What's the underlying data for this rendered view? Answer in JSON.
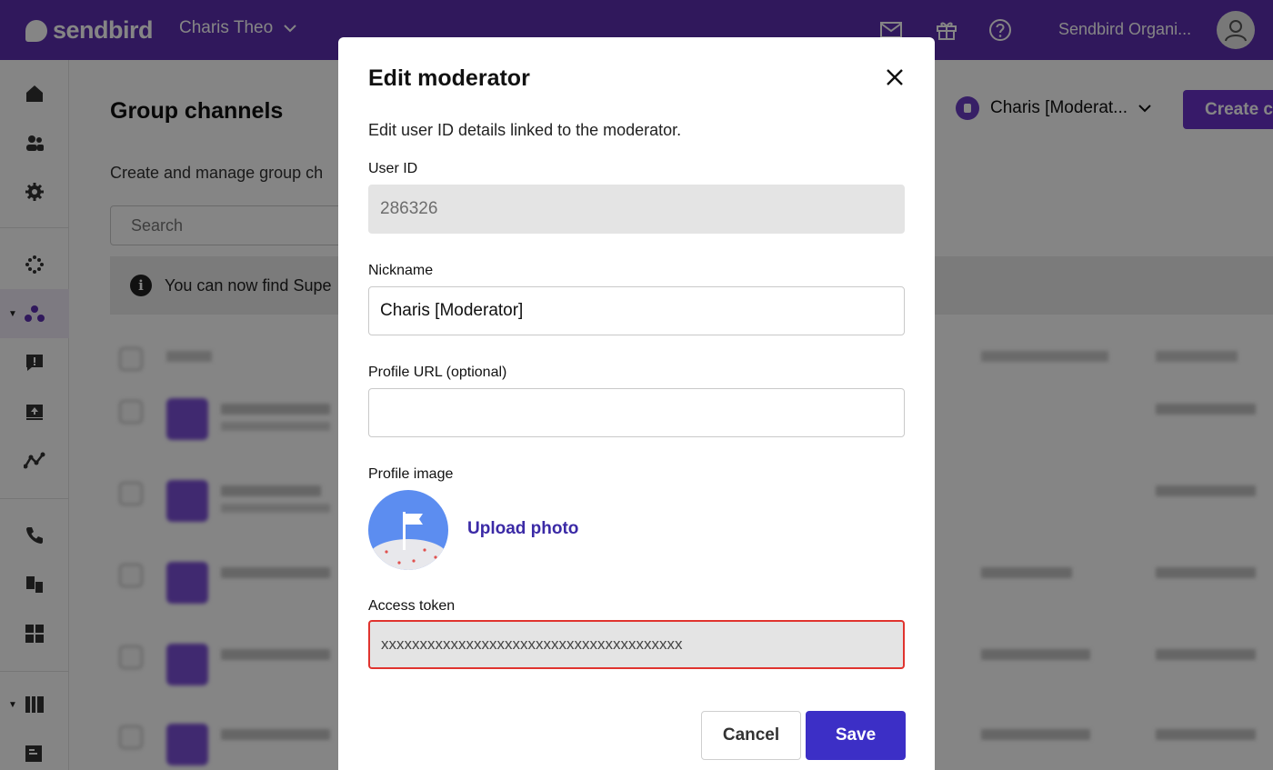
{
  "topbar": {
    "brand": "sendbird",
    "user_name": "Charis Theo",
    "org_name": "Sendbird Organi...",
    "icons": [
      "mail-icon",
      "gift-icon",
      "help-icon"
    ]
  },
  "sidebar": {
    "items": [
      "home-icon",
      "users-icon",
      "settings-icon",
      "dots-grid-icon",
      "group-channels-icon",
      "moderation-icon",
      "announcements-icon",
      "analytics-icon",
      "calls-icon",
      "devices-icon",
      "apps-icon",
      "desk-icon",
      "ticket-icon"
    ]
  },
  "main": {
    "title": "Group channels",
    "description": "Create and manage group ch",
    "search_placeholder": "Search",
    "info_text": "You can now find Supe",
    "moderator_select": "Charis [Moderat...",
    "create_button": "Create c"
  },
  "modal": {
    "title": "Edit moderator",
    "description": "Edit user ID details linked to the moderator.",
    "user_id_label": "User ID",
    "user_id_value": "286326",
    "nickname_label": "Nickname",
    "nickname_value": "Charis [Moderator]",
    "profile_url_label": "Profile URL (optional)",
    "profile_url_value": "",
    "profile_image_label": "Profile image",
    "upload_photo": "Upload photo",
    "access_token_label": "Access token",
    "access_token_value": "xxxxxxxxxxxxxxxxxxxxxxxxxxxxxxxxxxxxxxx",
    "cancel_label": "Cancel",
    "save_label": "Save"
  },
  "colors": {
    "brand_purple": "#5d2fb0",
    "save_blue": "#3c2fc6",
    "error_red": "#e0342f"
  }
}
